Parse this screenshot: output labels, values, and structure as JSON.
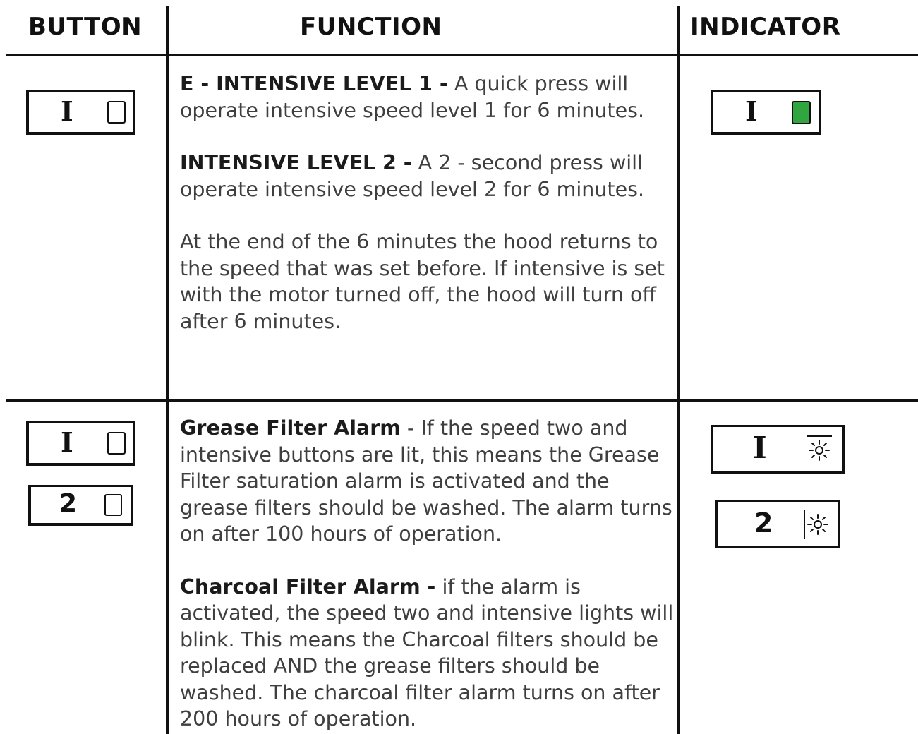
{
  "header": {
    "button": "BUTTON",
    "function": "FUNCTION",
    "indicator": "INDICATOR"
  },
  "rows": [
    {
      "button_symbols": [
        "I"
      ],
      "paragraphs": [
        {
          "bold": "E - INTENSIVE LEVEL 1 -",
          "text": " A quick press will operate intensive speed level 1 for 6 minutes."
        },
        {
          "bold": "INTENSIVE LEVEL 2 -",
          "text": " A 2 - second press will operate intensive speed level 2 for 6 minutes."
        },
        {
          "bold": "",
          "text": "At the end of the 6 minutes the hood returns to the speed that was set before. If intensive is set with the motor turned off, the hood will turn off after 6 minutes."
        }
      ],
      "indicator_symbols": [
        "I"
      ],
      "indicator_state": "lit-green"
    },
    {
      "button_symbols": [
        "I",
        "2"
      ],
      "paragraphs": [
        {
          "bold": "Grease Filter Alarm",
          "text": " - If the speed two and intensive buttons are lit, this means the Grease Filter saturation alarm is activated and the grease filters should be washed. The alarm turns on after 100 hours of operation."
        },
        {
          "bold": "Charcoal Filter Alarm -",
          "text": " if the alarm is activated, the speed two and intensive lights will blink. This means the Charcoal filters should be replaced AND the grease filters should be washed. The charcoal filter alarm turns on after 200 hours of operation."
        }
      ],
      "indicator_symbols": [
        "I",
        "2"
      ],
      "indicator_state": "blinking"
    }
  ],
  "colors": {
    "led_green": "#2fa640",
    "rule": "#111111",
    "text": "#3f3f3f"
  }
}
